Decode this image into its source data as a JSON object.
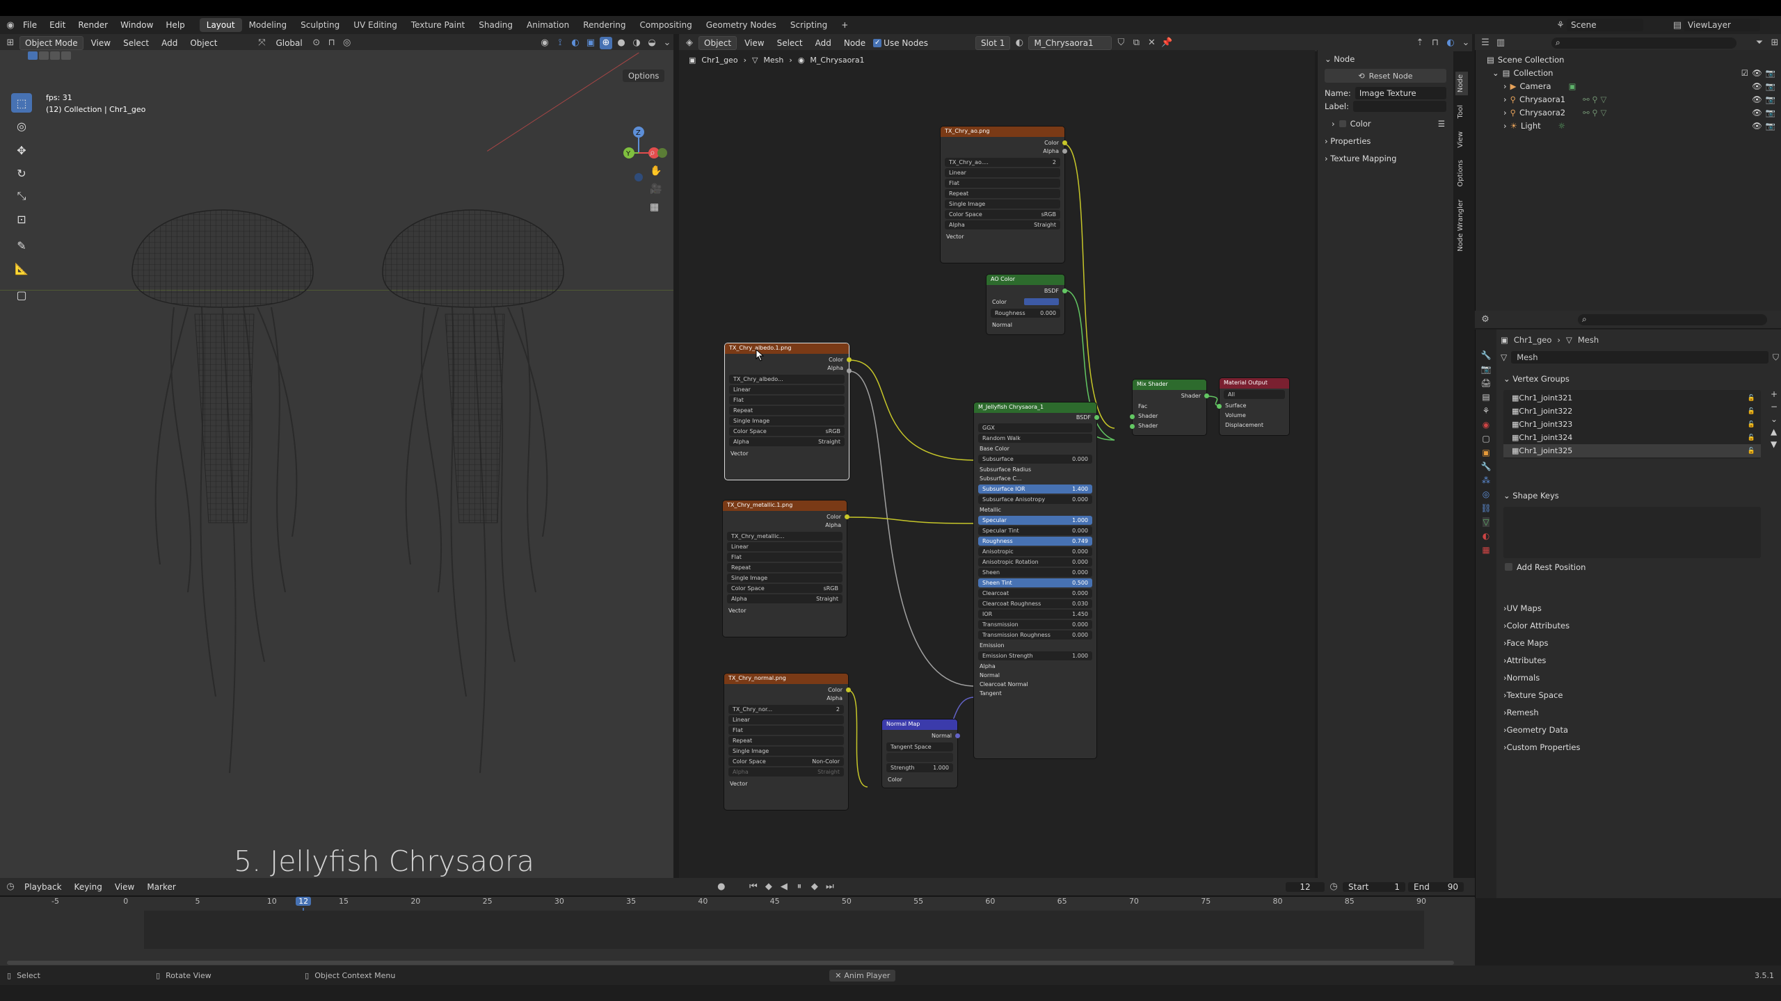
{
  "topbar": {
    "menus": [
      "File",
      "Edit",
      "Render",
      "Window",
      "Help"
    ],
    "workspaces": [
      "Layout",
      "Modeling",
      "Sculpting",
      "UV Editing",
      "Texture Paint",
      "Shading",
      "Animation",
      "Rendering",
      "Compositing",
      "Geometry Nodes",
      "Scripting"
    ],
    "add_tab": "+",
    "scene_label": "Scene",
    "viewlayer_label": "ViewLayer"
  },
  "viewport": {
    "mode": "Object Mode",
    "menus": [
      "View",
      "Select",
      "Add",
      "Object"
    ],
    "orientation": "Global",
    "options": "Options",
    "fps": "fps: 31",
    "collection": "(12) Collection | Chr1_geo",
    "caption": "5. Jellyfish Chrysaora",
    "gizmo": {
      "z": "Z",
      "y": "Y"
    }
  },
  "node_editor": {
    "type_menu": "Object",
    "menus": [
      "View",
      "Select",
      "Add",
      "Node"
    ],
    "use_nodes": "Use Nodes",
    "slot": "Slot 1",
    "material": "M_Chrysaora1",
    "breadcrumb": [
      "Chr1_geo",
      "Mesh",
      "M_Chrysaora1"
    ],
    "nodes": {
      "ao": {
        "title": "TX_Chry_ao.png",
        "out": [
          "Color",
          "Alpha"
        ],
        "img": "TX_Chry_ao....",
        "users": "2",
        "fields": [
          "Linear",
          "Flat",
          "Repeat",
          "Single Image"
        ],
        "cs_label": "Color Space",
        "cs": "sRGB",
        "alpha_label": "Alpha",
        "alpha": "Straight",
        "vector": "Vector"
      },
      "aocolor": {
        "title": "AO Color",
        "bsdf": "BSDF",
        "color": "Color",
        "roughness": "Roughness",
        "rough_val": "0.000",
        "normal": "Normal"
      },
      "albedo": {
        "title": "TX_Chry_albedo.1.png",
        "out": [
          "Color",
          "Alpha"
        ],
        "img": "TX_Chry_albedo...",
        "fields": [
          "Linear",
          "Flat",
          "Repeat",
          "Single Image"
        ],
        "cs_label": "Color Space",
        "cs": "sRGB",
        "alpha_label": "Alpha",
        "alpha": "Straight",
        "vector": "Vector"
      },
      "metallic": {
        "title": "TX_Chry_metallic.1.png",
        "out": [
          "Color",
          "Alpha"
        ],
        "img": "TX_Chry_metallic...",
        "fields": [
          "Linear",
          "Flat",
          "Repeat",
          "Single Image"
        ],
        "cs_label": "Color Space",
        "cs": "sRGB",
        "alpha_label": "Alpha",
        "alpha": "Straight",
        "vector": "Vector"
      },
      "normal": {
        "title": "TX_Chry_normal.png",
        "out": [
          "Color",
          "Alpha"
        ],
        "img": "TX_Chry_nor...",
        "users": "2",
        "fields": [
          "Linear",
          "Flat",
          "Repeat",
          "Single Image"
        ],
        "cs_label": "Color Space",
        "cs": "Non-Color",
        "alpha_label": "Alpha",
        "alpha": "Straight",
        "vector": "Vector"
      },
      "normalmap": {
        "title": "Normal Map",
        "normal": "Normal",
        "space": "Tangent Space",
        "strength": "Strength",
        "strength_val": "1.000",
        "color": "Color"
      },
      "principled": {
        "title": "M_Jellyfish Chrysaora_1",
        "bsdf": "BSDF",
        "dist": "GGX",
        "sss": "Random Walk",
        "base": "Base Color",
        "rows": [
          [
            "Subsurface",
            "0.000"
          ],
          [
            "Subsurface Radius",
            ""
          ],
          [
            "Subsurface C...",
            ""
          ],
          [
            "Subsurface IOR",
            "1.400"
          ],
          [
            "Subsurface Anisotropy",
            "0.000"
          ],
          [
            "Metallic",
            ""
          ],
          [
            "Specular",
            "1.000"
          ],
          [
            "Specular Tint",
            "0.000"
          ],
          [
            "Roughness",
            "0.749"
          ],
          [
            "Anisotropic",
            "0.000"
          ],
          [
            "Anisotropic Rotation",
            "0.000"
          ],
          [
            "Sheen",
            "0.000"
          ],
          [
            "Sheen Tint",
            "0.500"
          ],
          [
            "Clearcoat",
            "0.000"
          ],
          [
            "Clearcoat Roughness",
            "0.030"
          ],
          [
            "IOR",
            "1.450"
          ],
          [
            "Transmission",
            "0.000"
          ],
          [
            "Transmission Roughness",
            "0.000"
          ],
          [
            "Emission",
            ""
          ],
          [
            "Emission Strength",
            "1.000"
          ],
          [
            "Alpha",
            ""
          ],
          [
            "Normal",
            ""
          ],
          [
            "Clearcoat Normal",
            ""
          ],
          [
            "Tangent",
            ""
          ]
        ]
      },
      "mix": {
        "title": "Mix Shader",
        "shader": "Shader",
        "fac": "Fac",
        "in1": "Shader",
        "in2": "Shader"
      },
      "output": {
        "title": "Material Output",
        "target": "All",
        "surface": "Surface",
        "volume": "Volume",
        "disp": "Displacement"
      }
    }
  },
  "node_panel": {
    "section": "Node",
    "reset": "Reset Node",
    "name_label": "Name:",
    "name_value": "Image Texture",
    "label_label": "Label:",
    "color": "Color",
    "properties": "Properties",
    "texture_mapping": "Texture Mapping",
    "tabs": [
      "Node",
      "Tool",
      "View",
      "Options",
      "Node Wrangler"
    ]
  },
  "outliner": {
    "root": "Scene Collection",
    "collection": "Collection",
    "items": [
      "Camera",
      "Chrysaora1",
      "Chrysaora2",
      "Light"
    ]
  },
  "properties": {
    "breadcrumb": [
      "Chr1_geo",
      "Mesh"
    ],
    "mesh_name": "Mesh",
    "vertex_groups_title": "Vertex Groups",
    "vertex_groups": [
      "Chr1_joint321",
      "Chr1_joint322",
      "Chr1_joint323",
      "Chr1_joint324",
      "Chr1_joint325"
    ],
    "shape_keys": "Shape Keys",
    "add_rest": "Add Rest Position",
    "panels": [
      "UV Maps",
      "Color Attributes",
      "Face Maps",
      "Attributes",
      "Normals",
      "Texture Space",
      "Remesh",
      "Geometry Data",
      "Custom Properties"
    ]
  },
  "timeline": {
    "menus": [
      "Playback",
      "Keying",
      "View",
      "Marker"
    ],
    "current": "12",
    "start_label": "Start",
    "start": "1",
    "end_label": "End",
    "end": "90",
    "ticks": [
      "-5",
      "0",
      "5",
      "10",
      "12",
      "15",
      "20",
      "25",
      "30",
      "35",
      "40",
      "45",
      "50",
      "55",
      "60",
      "65",
      "70",
      "75",
      "80",
      "85",
      "90"
    ]
  },
  "status": {
    "select": "Select",
    "rotate": "Rotate View",
    "context": "Object Context Menu",
    "anim": "Anim Player",
    "version": "3.5.1"
  }
}
